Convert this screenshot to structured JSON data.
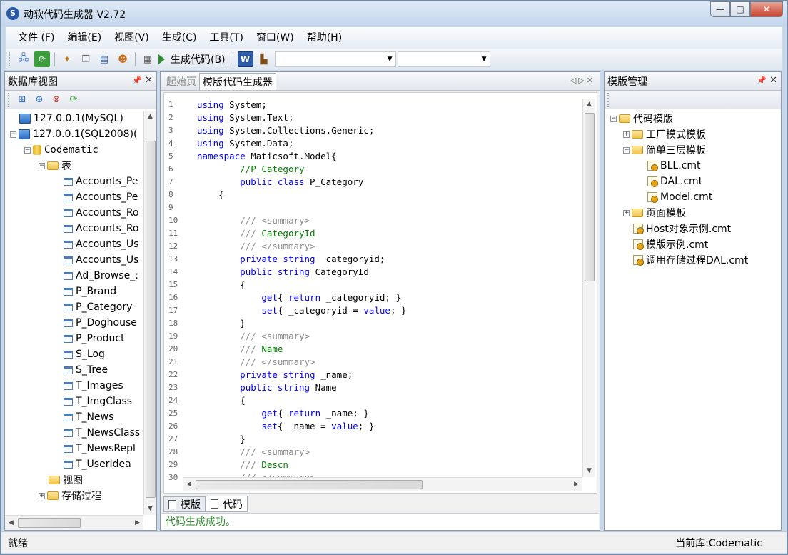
{
  "window": {
    "title": "动软代码生成器  V2.72",
    "logo_char": "S"
  },
  "menu": [
    {
      "label": "文件 (F)"
    },
    {
      "label": "编辑(E)"
    },
    {
      "label": "视图(V)"
    },
    {
      "label": "生成(C)"
    },
    {
      "label": "工具(T)"
    },
    {
      "label": "窗口(W)"
    },
    {
      "label": "帮助(H)"
    }
  ],
  "toolbar": {
    "generate_label": "生成代码(B)"
  },
  "left_panel": {
    "title": "数据库视图",
    "servers": [
      {
        "label": "127.0.0.1(MySQL)"
      },
      {
        "label": "127.0.0.1(SQL2008)("
      }
    ],
    "database": "Codematic",
    "tables_folder": "表",
    "tables": [
      "Accounts_Pe",
      "Accounts_Pe",
      "Accounts_Ro",
      "Accounts_Ro",
      "Accounts_Us",
      "Accounts_Us",
      "Ad_Browse_:",
      "P_Brand",
      "P_Category",
      "P_Doghouse",
      "P_Product",
      "S_Log",
      "S_Tree",
      "T_Images",
      "T_ImgClass",
      "T_News",
      "T_NewsClass",
      "T_NewsRepl",
      "T_UserIdea"
    ],
    "views_folder": "视图",
    "procs_folder": "存储过程"
  },
  "center": {
    "tabs": [
      {
        "label": "起始页",
        "active": false
      },
      {
        "label": "模版代码生成器",
        "active": true
      }
    ],
    "line_numbers": [
      "1",
      "2",
      "3",
      "4",
      "5",
      "6",
      "7",
      "8",
      "9",
      "10",
      "11",
      "12",
      "13",
      "14",
      "15",
      "16",
      "17",
      "18",
      "19",
      "20",
      "21",
      "22",
      "23",
      "24",
      "25",
      "26",
      "27",
      "28",
      "29",
      "30"
    ],
    "bottom_tabs": [
      {
        "label": "模版"
      },
      {
        "label": "代码"
      }
    ],
    "output_text": "代码生成成功。"
  },
  "right_panel": {
    "title": "模版管理",
    "root": "代码模版",
    "items": [
      {
        "label": "工厂模式模板",
        "type": "folder",
        "level": 1,
        "expander": "+"
      },
      {
        "label": "简单三层模板",
        "type": "folder",
        "level": 1,
        "expander": "-"
      },
      {
        "label": "BLL.cmt",
        "type": "file",
        "level": 2
      },
      {
        "label": "DAL.cmt",
        "type": "file",
        "level": 2
      },
      {
        "label": "Model.cmt",
        "type": "file",
        "level": 2
      },
      {
        "label": "页面模板",
        "type": "folder",
        "level": 1,
        "expander": "+"
      },
      {
        "label": "Host对象示例.cmt",
        "type": "file",
        "level": 1
      },
      {
        "label": "模版示例.cmt",
        "type": "file",
        "level": 1
      },
      {
        "label": "调用存储过程DAL.cmt",
        "type": "file",
        "level": 1
      }
    ]
  },
  "status": {
    "left": "就绪",
    "right": "当前库:Codematic"
  },
  "colors": {
    "keyword": "#0000ff",
    "comment": "#008000",
    "output_text": "#2e8b2e"
  }
}
